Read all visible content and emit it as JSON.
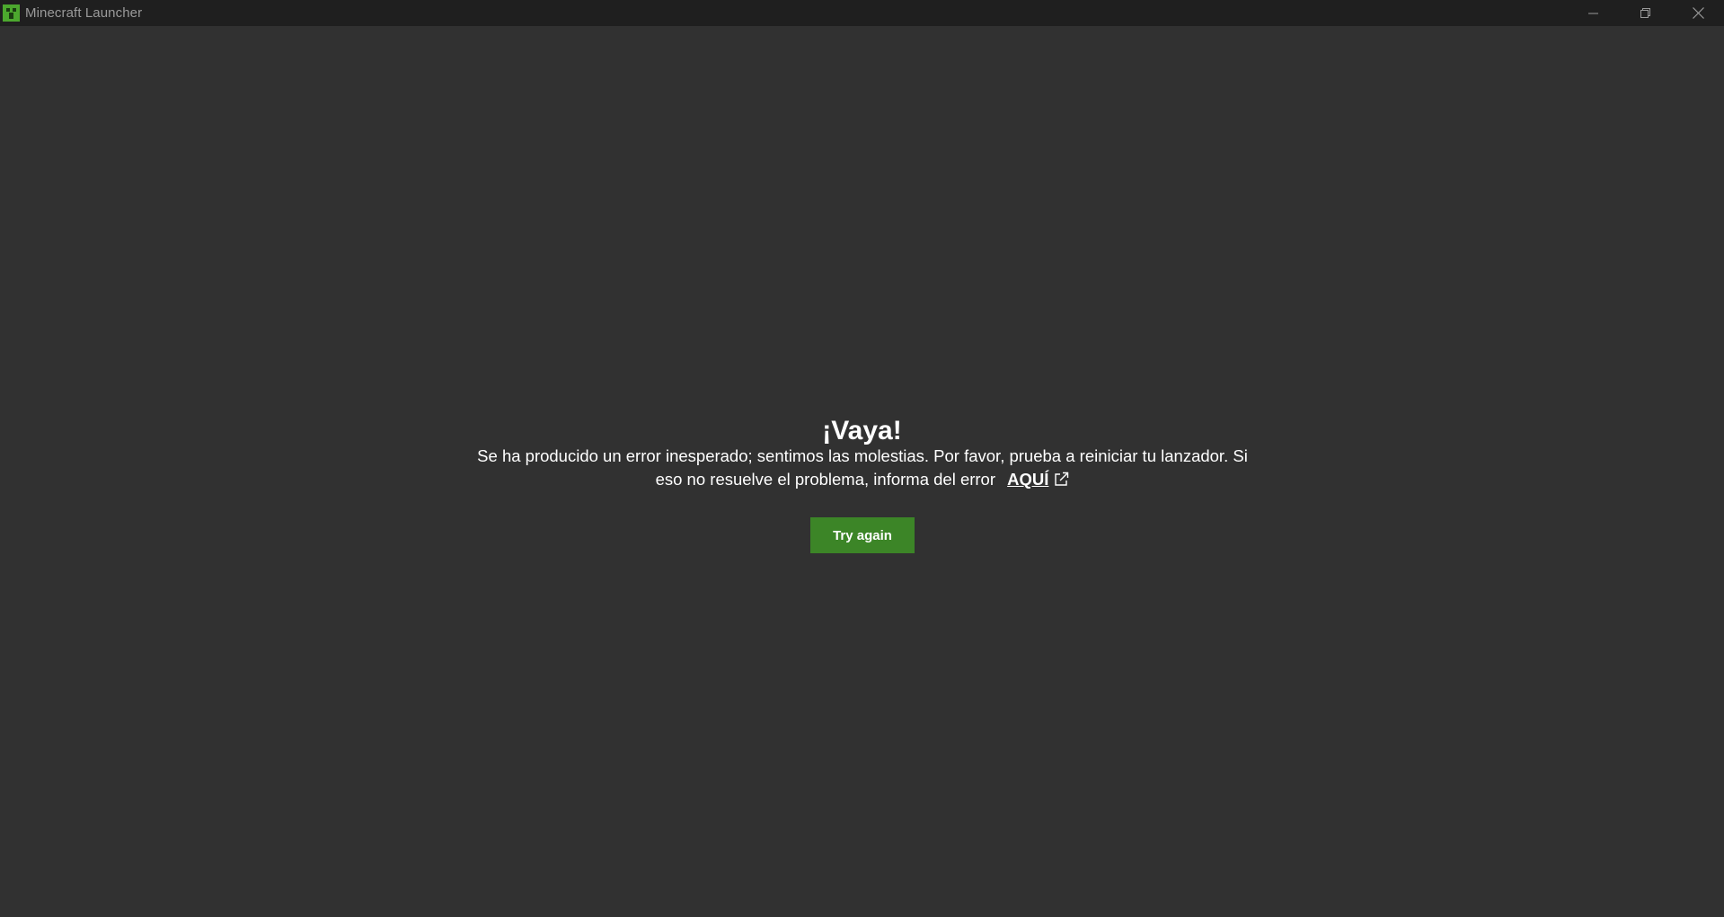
{
  "window": {
    "title": "Minecraft Launcher",
    "controls": {
      "minimize_icon": "minimize-icon",
      "restore_icon": "restore-icon",
      "close_icon": "close-icon"
    }
  },
  "error": {
    "heading": "¡Vaya!",
    "message_line1": "Se ha producido un error inesperado; sentimos las molestias. Por favor, prueba a reiniciar tu lanzador. Si",
    "message_line2": "eso no resuelve el problema, informa del error",
    "link_label": "AQUÍ",
    "link_icon": "external-link-icon",
    "retry_label": "Try again"
  },
  "colors": {
    "background": "#313131",
    "titlebar": "#1f1f1f",
    "accent_green": "#3c8527",
    "text": "#ffffff"
  }
}
